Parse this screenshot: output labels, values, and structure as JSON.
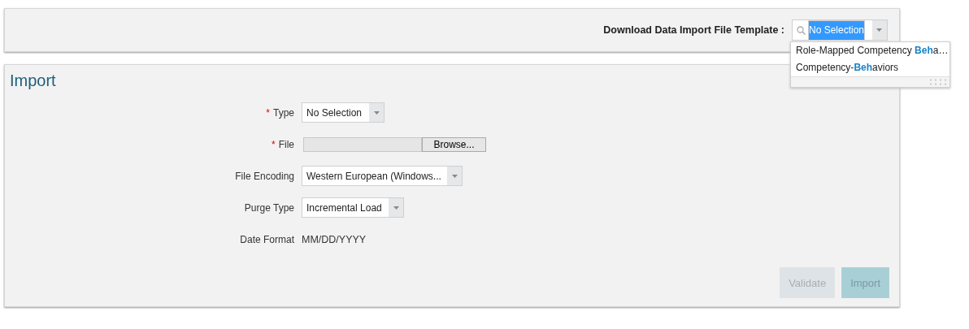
{
  "template": {
    "label": "Download Data Import File Template :",
    "value": "No Selection",
    "value_selected": true,
    "options": [
      "Role-Mapped Competency **Beh**a…",
      "Competency-**Beh**aviors"
    ]
  },
  "import": {
    "title": "Import",
    "fields": [
      {
        "kind": "select",
        "label": "Type",
        "required_mark": "*",
        "value": "No Selection"
      },
      {
        "kind": "file",
        "label": "File",
        "required_mark": "*",
        "button": "Browse..."
      },
      {
        "kind": "select",
        "label": "File Encoding",
        "value": "Western European (Windows..."
      },
      {
        "kind": "select",
        "label": "Purge Type",
        "value": "Incremental Load"
      },
      {
        "kind": "text",
        "label": "Date Format",
        "value": "MM/DD/YYYY"
      }
    ],
    "buttons": [
      {
        "label": "Validate",
        "disabled": true,
        "kind": "plain"
      },
      {
        "label": "Import",
        "disabled": true,
        "kind": "primary"
      }
    ]
  }
}
